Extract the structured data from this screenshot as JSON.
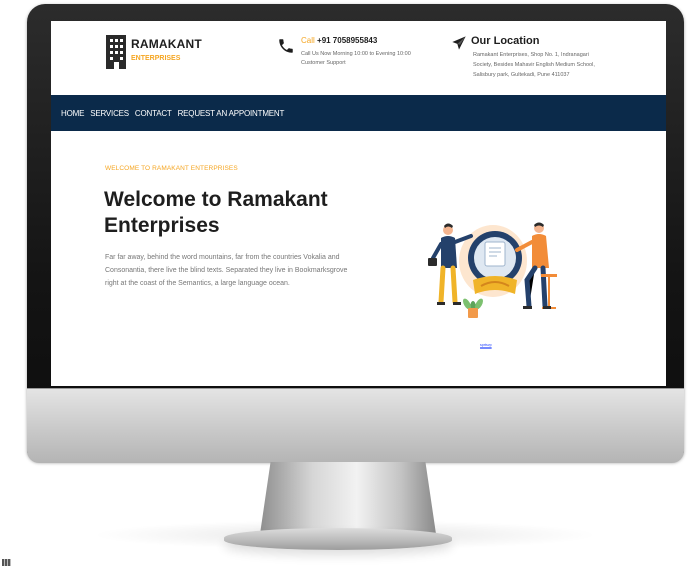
{
  "brand": {
    "name": "RAMAKANT",
    "tagline": "ENTERPRISES"
  },
  "contact": {
    "call_label": "Call",
    "phone": "+91 7058955843",
    "hours_line1": "Call Us Now Morning 10:00 to Evening 10:00",
    "hours_line2": "Customer Support"
  },
  "location": {
    "title": "Our Location",
    "line1": "Ramakant Enterprises, Shop No. 1, Indranagari",
    "line2": "Society, Besides Mahavir English Medium School,",
    "line3": "Salisbury park, Gultekadi, Pune 411037"
  },
  "nav": {
    "items": [
      {
        "label": "HOME"
      },
      {
        "label": "SERVICES"
      },
      {
        "label": "CONTACT"
      },
      {
        "label": "REQUEST AN APPOINTMENT"
      }
    ]
  },
  "hero": {
    "kicker": "WELCOME TO RAMAKANT ENTERPRISES",
    "title": "Welcome to Ramakant Enterprises",
    "text": "Far far away, behind the word mountains, far from the countries Vokalia and Consonantia, there live the blind texts. Separated they live in Bookmarksgrove right at the coast of the Semantics, a large language ocean.",
    "link": "sprtsvp"
  },
  "colors": {
    "accent": "#f5a623",
    "nav_bg": "#0b2a4a",
    "text_dark": "#1e1e1e"
  },
  "icons": {
    "logo": "building-icon",
    "phone": "phone-icon",
    "location": "paper-plane-icon"
  }
}
